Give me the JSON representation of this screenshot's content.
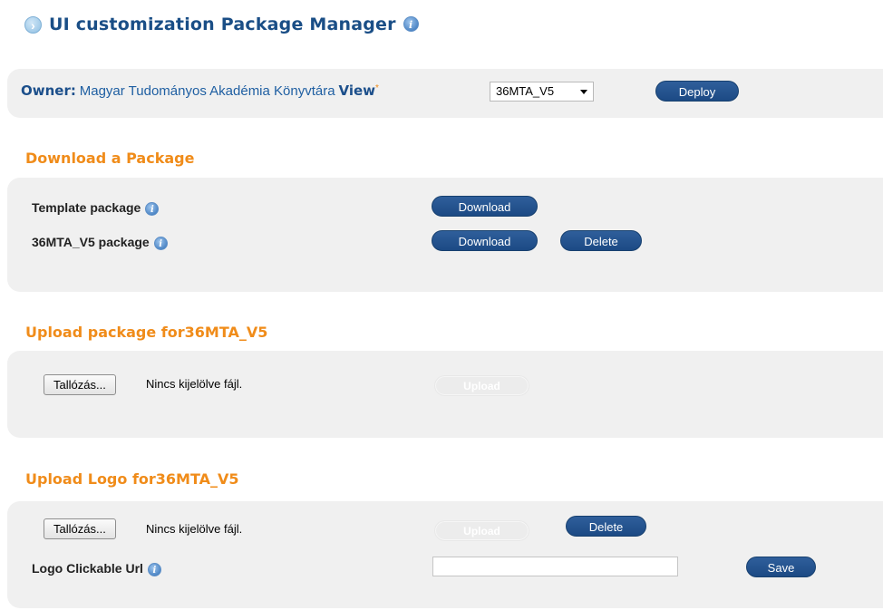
{
  "header": {
    "title": "UI customization Package Manager",
    "chevron": "›",
    "info_glyph": "i"
  },
  "owner": {
    "owner_label": "Owner:",
    "owner_value": "Magyar Tudományos Akadémia Könyvtára",
    "view_label": "View",
    "view_required_mark": "*",
    "view_selected": "36MTA_V5",
    "deploy_label": "Deploy"
  },
  "download": {
    "heading": "Download a Package",
    "rows": [
      {
        "label": "Template package",
        "download_label": "Download"
      },
      {
        "label": "36MTA_V5 package",
        "download_label": "Download",
        "delete_label": "Delete"
      }
    ]
  },
  "upload_package": {
    "heading": "Upload package for36MTA_V5",
    "browse_label": "Tallózás...",
    "file_status": "Nincs kijelölve fájl.",
    "upload_label": "Upload"
  },
  "upload_logo": {
    "heading": "Upload Logo for36MTA_V5",
    "browse_label": "Tallózás...",
    "file_status": "Nincs kijelölve fájl.",
    "upload_label": "Upload",
    "delete_label": "Delete",
    "url_label": "Logo Clickable Url",
    "url_value": "",
    "save_label": "Save"
  },
  "colors": {
    "title": "#1a4e86",
    "heading_orange": "#f08c1a",
    "button_blue": "#1f4f8a",
    "panel_gray": "#f0f0f0"
  },
  "icons": [
    "chevron-right-icon",
    "info-icon",
    "dropdown-caret-icon"
  ]
}
